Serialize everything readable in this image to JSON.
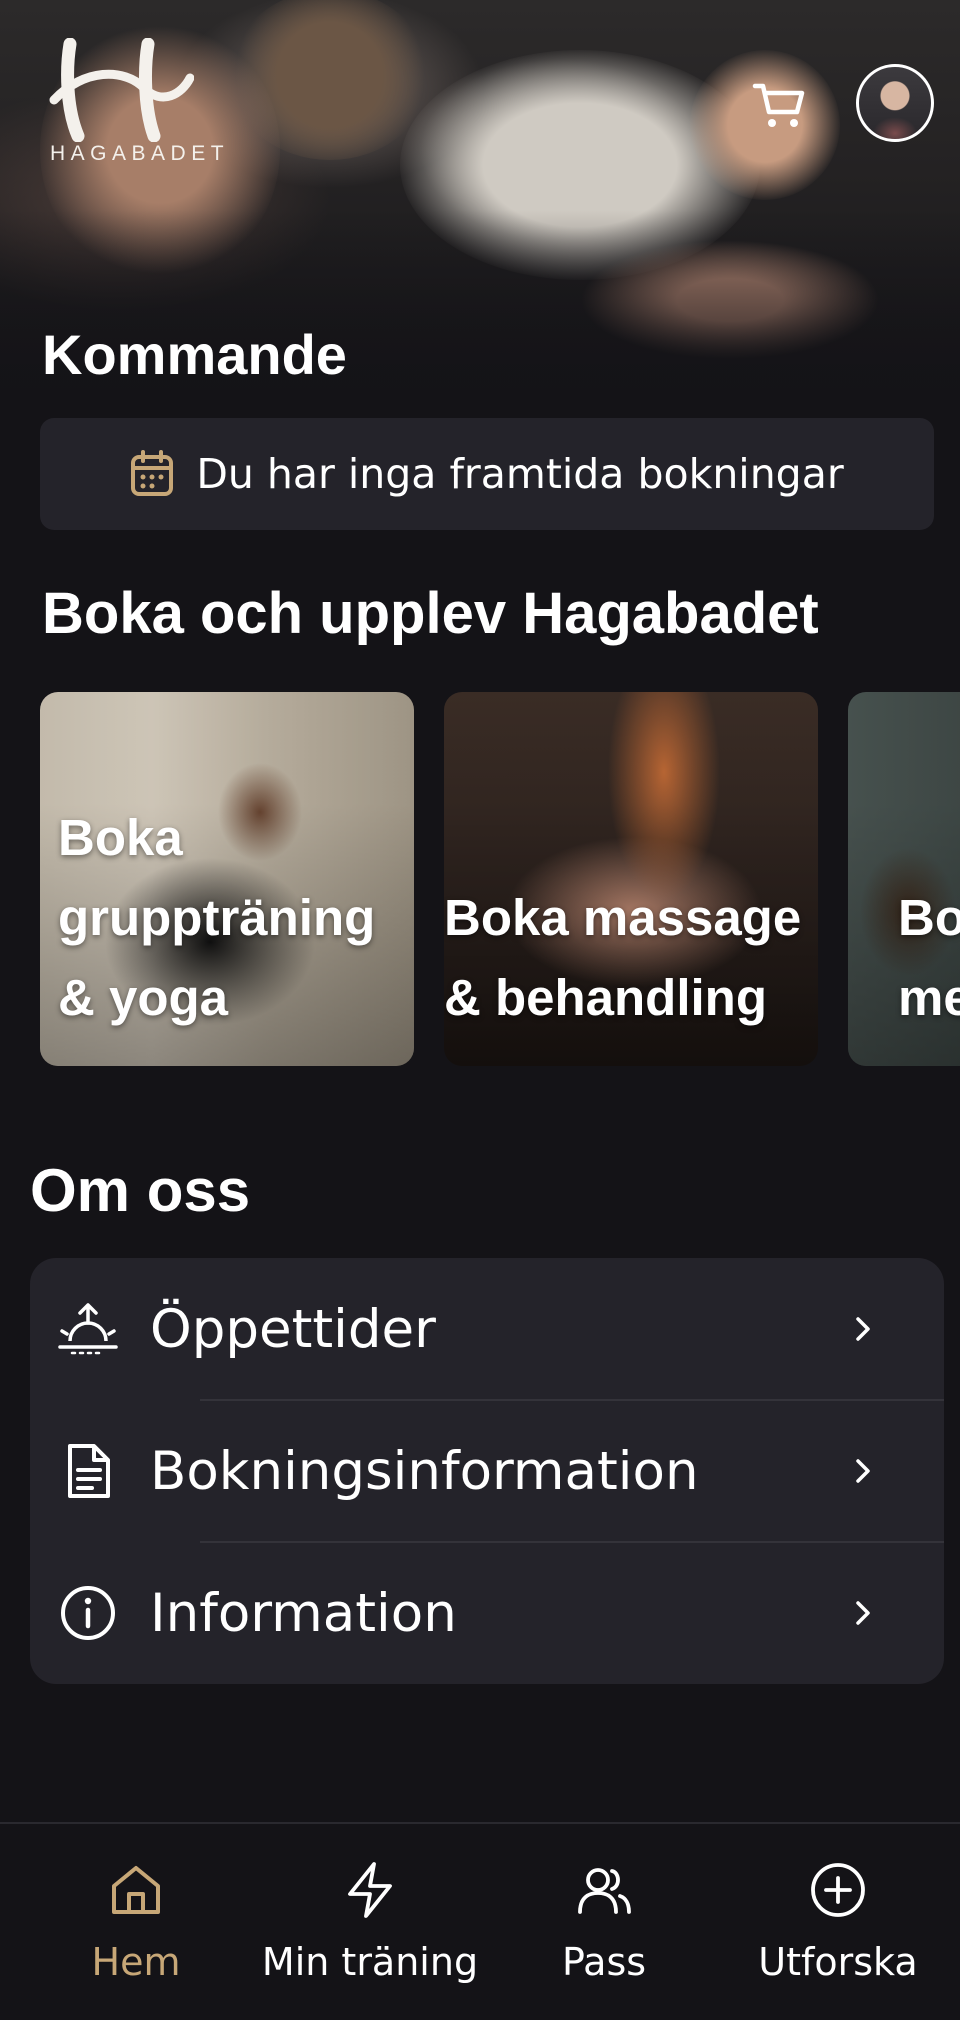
{
  "brand": {
    "logo_text": "HAGABADET"
  },
  "header": {
    "cart_icon": "cart-icon",
    "avatar": "profile-avatar"
  },
  "upcoming": {
    "title": "Kommande",
    "empty_message": "Du har inga framtida bokningar",
    "icon": "calendar-icon"
  },
  "book": {
    "title": "Boka och upplev Hagabadet",
    "cards": [
      {
        "label": "Boka gruppträning & yoga"
      },
      {
        "label": "Boka massage & behandling"
      },
      {
        "label": "Boka Vitalitet med"
      }
    ]
  },
  "about": {
    "title": "Om oss",
    "items": [
      {
        "label": "Öppettider",
        "icon": "sunrise-icon"
      },
      {
        "label": "Bokningsinformation",
        "icon": "document-icon"
      },
      {
        "label": "Information",
        "icon": "info-icon"
      }
    ]
  },
  "tabbar": {
    "items": [
      {
        "label": "Hem",
        "icon": "home-icon",
        "active": true
      },
      {
        "label": "Min träning",
        "icon": "lightning-icon",
        "active": false
      },
      {
        "label": "Pass",
        "icon": "people-icon",
        "active": false
      },
      {
        "label": "Utforska",
        "icon": "plus-circle-icon",
        "active": false
      }
    ]
  },
  "colors": {
    "accent": "#c7a777",
    "background": "#141317",
    "surface": "#24232a"
  }
}
